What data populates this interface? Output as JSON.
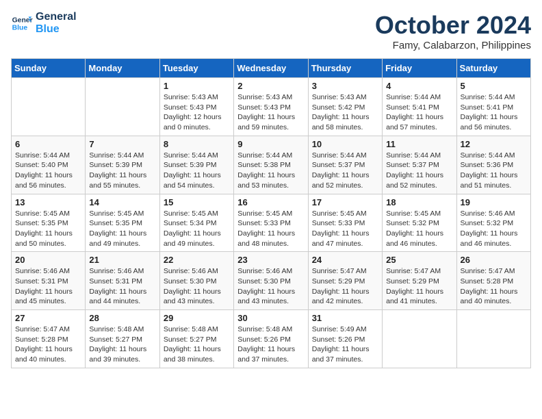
{
  "header": {
    "logo_line1": "General",
    "logo_line2": "Blue",
    "month": "October 2024",
    "location": "Famy, Calabarzon, Philippines"
  },
  "days_of_week": [
    "Sunday",
    "Monday",
    "Tuesday",
    "Wednesday",
    "Thursday",
    "Friday",
    "Saturday"
  ],
  "weeks": [
    [
      {
        "day": "",
        "sunrise": "",
        "sunset": "",
        "daylight": ""
      },
      {
        "day": "",
        "sunrise": "",
        "sunset": "",
        "daylight": ""
      },
      {
        "day": "1",
        "sunrise": "Sunrise: 5:43 AM",
        "sunset": "Sunset: 5:43 PM",
        "daylight": "Daylight: 12 hours and 0 minutes."
      },
      {
        "day": "2",
        "sunrise": "Sunrise: 5:43 AM",
        "sunset": "Sunset: 5:43 PM",
        "daylight": "Daylight: 11 hours and 59 minutes."
      },
      {
        "day": "3",
        "sunrise": "Sunrise: 5:43 AM",
        "sunset": "Sunset: 5:42 PM",
        "daylight": "Daylight: 11 hours and 58 minutes."
      },
      {
        "day": "4",
        "sunrise": "Sunrise: 5:44 AM",
        "sunset": "Sunset: 5:41 PM",
        "daylight": "Daylight: 11 hours and 57 minutes."
      },
      {
        "day": "5",
        "sunrise": "Sunrise: 5:44 AM",
        "sunset": "Sunset: 5:41 PM",
        "daylight": "Daylight: 11 hours and 56 minutes."
      }
    ],
    [
      {
        "day": "6",
        "sunrise": "Sunrise: 5:44 AM",
        "sunset": "Sunset: 5:40 PM",
        "daylight": "Daylight: 11 hours and 56 minutes."
      },
      {
        "day": "7",
        "sunrise": "Sunrise: 5:44 AM",
        "sunset": "Sunset: 5:39 PM",
        "daylight": "Daylight: 11 hours and 55 minutes."
      },
      {
        "day": "8",
        "sunrise": "Sunrise: 5:44 AM",
        "sunset": "Sunset: 5:39 PM",
        "daylight": "Daylight: 11 hours and 54 minutes."
      },
      {
        "day": "9",
        "sunrise": "Sunrise: 5:44 AM",
        "sunset": "Sunset: 5:38 PM",
        "daylight": "Daylight: 11 hours and 53 minutes."
      },
      {
        "day": "10",
        "sunrise": "Sunrise: 5:44 AM",
        "sunset": "Sunset: 5:37 PM",
        "daylight": "Daylight: 11 hours and 52 minutes."
      },
      {
        "day": "11",
        "sunrise": "Sunrise: 5:44 AM",
        "sunset": "Sunset: 5:37 PM",
        "daylight": "Daylight: 11 hours and 52 minutes."
      },
      {
        "day": "12",
        "sunrise": "Sunrise: 5:44 AM",
        "sunset": "Sunset: 5:36 PM",
        "daylight": "Daylight: 11 hours and 51 minutes."
      }
    ],
    [
      {
        "day": "13",
        "sunrise": "Sunrise: 5:45 AM",
        "sunset": "Sunset: 5:35 PM",
        "daylight": "Daylight: 11 hours and 50 minutes."
      },
      {
        "day": "14",
        "sunrise": "Sunrise: 5:45 AM",
        "sunset": "Sunset: 5:35 PM",
        "daylight": "Daylight: 11 hours and 49 minutes."
      },
      {
        "day": "15",
        "sunrise": "Sunrise: 5:45 AM",
        "sunset": "Sunset: 5:34 PM",
        "daylight": "Daylight: 11 hours and 49 minutes."
      },
      {
        "day": "16",
        "sunrise": "Sunrise: 5:45 AM",
        "sunset": "Sunset: 5:33 PM",
        "daylight": "Daylight: 11 hours and 48 minutes."
      },
      {
        "day": "17",
        "sunrise": "Sunrise: 5:45 AM",
        "sunset": "Sunset: 5:33 PM",
        "daylight": "Daylight: 11 hours and 47 minutes."
      },
      {
        "day": "18",
        "sunrise": "Sunrise: 5:45 AM",
        "sunset": "Sunset: 5:32 PM",
        "daylight": "Daylight: 11 hours and 46 minutes."
      },
      {
        "day": "19",
        "sunrise": "Sunrise: 5:46 AM",
        "sunset": "Sunset: 5:32 PM",
        "daylight": "Daylight: 11 hours and 46 minutes."
      }
    ],
    [
      {
        "day": "20",
        "sunrise": "Sunrise: 5:46 AM",
        "sunset": "Sunset: 5:31 PM",
        "daylight": "Daylight: 11 hours and 45 minutes."
      },
      {
        "day": "21",
        "sunrise": "Sunrise: 5:46 AM",
        "sunset": "Sunset: 5:31 PM",
        "daylight": "Daylight: 11 hours and 44 minutes."
      },
      {
        "day": "22",
        "sunrise": "Sunrise: 5:46 AM",
        "sunset": "Sunset: 5:30 PM",
        "daylight": "Daylight: 11 hours and 43 minutes."
      },
      {
        "day": "23",
        "sunrise": "Sunrise: 5:46 AM",
        "sunset": "Sunset: 5:30 PM",
        "daylight": "Daylight: 11 hours and 43 minutes."
      },
      {
        "day": "24",
        "sunrise": "Sunrise: 5:47 AM",
        "sunset": "Sunset: 5:29 PM",
        "daylight": "Daylight: 11 hours and 42 minutes."
      },
      {
        "day": "25",
        "sunrise": "Sunrise: 5:47 AM",
        "sunset": "Sunset: 5:29 PM",
        "daylight": "Daylight: 11 hours and 41 minutes."
      },
      {
        "day": "26",
        "sunrise": "Sunrise: 5:47 AM",
        "sunset": "Sunset: 5:28 PM",
        "daylight": "Daylight: 11 hours and 40 minutes."
      }
    ],
    [
      {
        "day": "27",
        "sunrise": "Sunrise: 5:47 AM",
        "sunset": "Sunset: 5:28 PM",
        "daylight": "Daylight: 11 hours and 40 minutes."
      },
      {
        "day": "28",
        "sunrise": "Sunrise: 5:48 AM",
        "sunset": "Sunset: 5:27 PM",
        "daylight": "Daylight: 11 hours and 39 minutes."
      },
      {
        "day": "29",
        "sunrise": "Sunrise: 5:48 AM",
        "sunset": "Sunset: 5:27 PM",
        "daylight": "Daylight: 11 hours and 38 minutes."
      },
      {
        "day": "30",
        "sunrise": "Sunrise: 5:48 AM",
        "sunset": "Sunset: 5:26 PM",
        "daylight": "Daylight: 11 hours and 37 minutes."
      },
      {
        "day": "31",
        "sunrise": "Sunrise: 5:49 AM",
        "sunset": "Sunset: 5:26 PM",
        "daylight": "Daylight: 11 hours and 37 minutes."
      },
      {
        "day": "",
        "sunrise": "",
        "sunset": "",
        "daylight": ""
      },
      {
        "day": "",
        "sunrise": "",
        "sunset": "",
        "daylight": ""
      }
    ]
  ]
}
